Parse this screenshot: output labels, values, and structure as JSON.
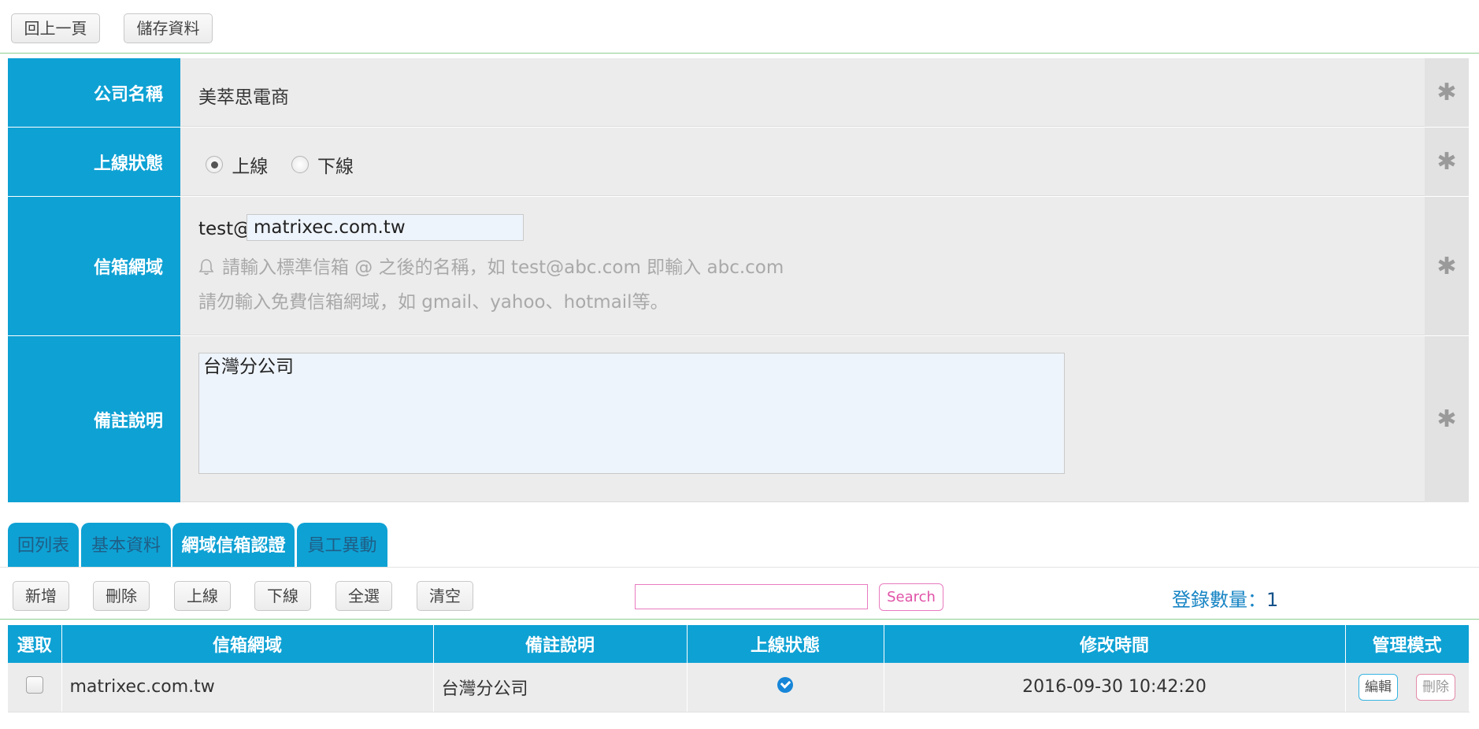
{
  "topbar": {
    "back_label": "回上一頁",
    "save_label": "儲存資料"
  },
  "form": {
    "company": {
      "label": "公司名稱",
      "value": "美萃思電商"
    },
    "status": {
      "label": "上線狀態",
      "online": "上線",
      "offline": "下線",
      "selected": "上線"
    },
    "domain": {
      "label": "信箱網域",
      "prefix": "test@",
      "value": "matrixec.com.tw",
      "hint1": "請輸入標準信箱 @ 之後的名稱，如 test@abc.com 即輸入 abc.com",
      "hint2": "請勿輸入免費信箱網域，如 gmail、yahoo、hotmail等。"
    },
    "note": {
      "label": "備註說明",
      "value": "台灣分公司"
    },
    "required_mark": "✱"
  },
  "tabs": [
    {
      "label": "回列表"
    },
    {
      "label": "基本資料"
    },
    {
      "label": "網域信箱認證"
    },
    {
      "label": "員工異動"
    }
  ],
  "toolbar": {
    "add": "新增",
    "delete": "刪除",
    "online": "上線",
    "offline": "下線",
    "select_all": "全選",
    "clear": "清空",
    "search_label": "Search",
    "count_label": "登錄數量：",
    "count_value": "1"
  },
  "table": {
    "headers": [
      "選取",
      "信箱網域",
      "備註說明",
      "上線狀態",
      "修改時間",
      "管理模式"
    ],
    "rows": [
      {
        "domain": "matrixec.com.tw",
        "note": "台灣分公司",
        "online": true,
        "modified": "2016-09-30 10:42:20",
        "edit": "編輯",
        "delete": "刪除"
      }
    ]
  },
  "colors": {
    "accent": "#0ea1d4",
    "search_border": "#e87bc0"
  }
}
